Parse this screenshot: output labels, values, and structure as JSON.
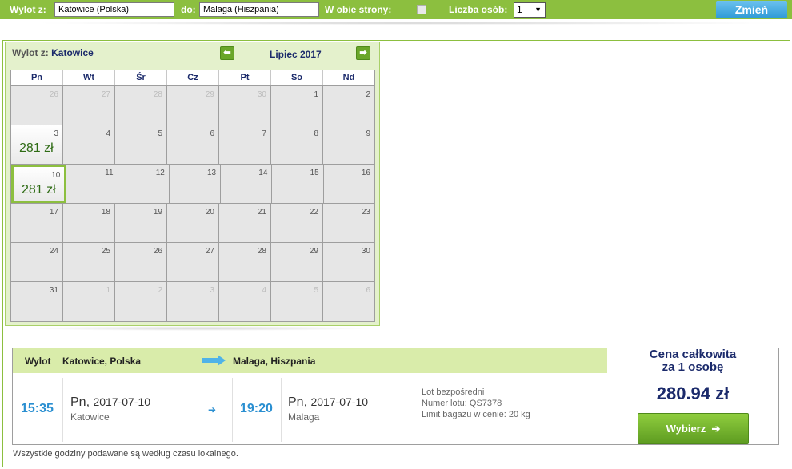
{
  "search": {
    "from_label": "Wylot z:",
    "from_value": "Katowice (Polska)",
    "to_label": "do:",
    "to_value": "Malaga (Hiszpania)",
    "roundtrip_label": "W obie strony:",
    "roundtrip_checked": false,
    "persons_label": "Liczba osób:",
    "persons_value": "1",
    "submit_label": "Zmień"
  },
  "calendar": {
    "departure_prefix": "Wylot z:",
    "departure_city": "Katowice",
    "month_label": "Lipiec 2017",
    "weekdays": [
      "Pn",
      "Wt",
      "Śr",
      "Cz",
      "Pt",
      "So",
      "Nd"
    ],
    "weeks": [
      [
        {
          "d": "26",
          "o": true
        },
        {
          "d": "27",
          "o": true
        },
        {
          "d": "28",
          "o": true
        },
        {
          "d": "29",
          "o": true
        },
        {
          "d": "30",
          "o": true
        },
        {
          "d": "1"
        },
        {
          "d": "2"
        }
      ],
      [
        {
          "d": "3",
          "price": "281 zł"
        },
        {
          "d": "4"
        },
        {
          "d": "5"
        },
        {
          "d": "6"
        },
        {
          "d": "7"
        },
        {
          "d": "8"
        },
        {
          "d": "9"
        }
      ],
      [
        {
          "d": "10",
          "price": "281 zł",
          "selected": true
        },
        {
          "d": "11"
        },
        {
          "d": "12"
        },
        {
          "d": "13"
        },
        {
          "d": "14"
        },
        {
          "d": "15"
        },
        {
          "d": "16"
        }
      ],
      [
        {
          "d": "17"
        },
        {
          "d": "18"
        },
        {
          "d": "19"
        },
        {
          "d": "20"
        },
        {
          "d": "21"
        },
        {
          "d": "22"
        },
        {
          "d": "23"
        }
      ],
      [
        {
          "d": "24"
        },
        {
          "d": "25"
        },
        {
          "d": "26"
        },
        {
          "d": "27"
        },
        {
          "d": "28"
        },
        {
          "d": "29"
        },
        {
          "d": "30"
        }
      ],
      [
        {
          "d": "31"
        },
        {
          "d": "1",
          "o": true
        },
        {
          "d": "2",
          "o": true
        },
        {
          "d": "3",
          "o": true
        },
        {
          "d": "4",
          "o": true
        },
        {
          "d": "5",
          "o": true
        },
        {
          "d": "6",
          "o": true
        }
      ]
    ]
  },
  "flight": {
    "direction_label": "Wylot",
    "origin": "Katowice, Polska",
    "destination": "Malaga, Hiszpania",
    "dep_time": "15:35",
    "dep_day": "Pn,",
    "dep_date": "2017-07-10",
    "dep_city": "Katowice",
    "arr_time": "19:20",
    "arr_day": "Pn,",
    "arr_date": "2017-07-10",
    "arr_city": "Malaga",
    "info_direct": "Lot bezpośredni",
    "info_flight_no": "Numer lotu: QS7378",
    "info_baggage": "Limit bagażu w cenie: 20 kg",
    "price_title_1": "Cena całkowita",
    "price_title_2": "za 1 osobę",
    "price": "280.94 zł",
    "select_label": "Wybierz"
  },
  "footer_note": "Wszystkie godziny podawane są według czasu lokalnego.",
  "colors": {
    "accent_green": "#8cbf3f",
    "header_blue": "#1b2a6b",
    "time_blue": "#2a8fd1"
  }
}
